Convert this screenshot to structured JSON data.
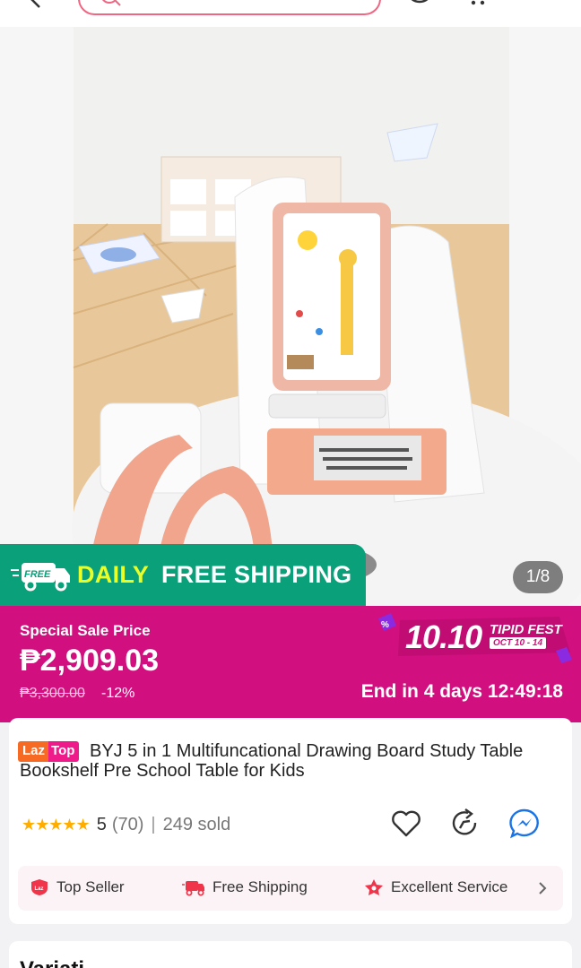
{
  "header": {
    "back_icon": "back-arrow-icon",
    "search_icon": "search-icon",
    "account_icon": "account-icon",
    "cart_icon": "cart-icon"
  },
  "gallery": {
    "counter": "1/8",
    "shipping_banner": {
      "badge": "FREE",
      "daily": "DAILY",
      "free_shipping": "FREE SHIPPING"
    }
  },
  "price": {
    "label": "Special Sale Price",
    "current": "₱2,909.03",
    "original": "₱3,300.00",
    "discount": "-12%",
    "countdown": "End in 4 days 12:49:18",
    "campaign": {
      "number": "10.10",
      "name": "TIPID FEST",
      "dates": "OCT 10 - 14"
    }
  },
  "product": {
    "badge_part1": "Laz",
    "badge_part2": "Top",
    "title": "BYJ 5 in 1 Multifuncational Drawing Board Study Table Bookshelf Pre School Table for Kids",
    "stars": "★★★★★",
    "rating": "5",
    "reviews": "(70)",
    "separator": "|",
    "sold": "249 sold"
  },
  "badges": [
    {
      "label": "Top Seller",
      "icon": "top-seller-icon"
    },
    {
      "label": "Free Shipping",
      "icon": "free-shipping-icon"
    },
    {
      "label": "Excellent Service",
      "icon": "excellent-service-icon"
    }
  ],
  "next_section": {
    "title": "Variati..."
  },
  "colors": {
    "brand_pink": "#d10f7e",
    "shipping_green": "#0aa07a",
    "star_orange": "#ffae00",
    "search_border": "#f06582"
  }
}
